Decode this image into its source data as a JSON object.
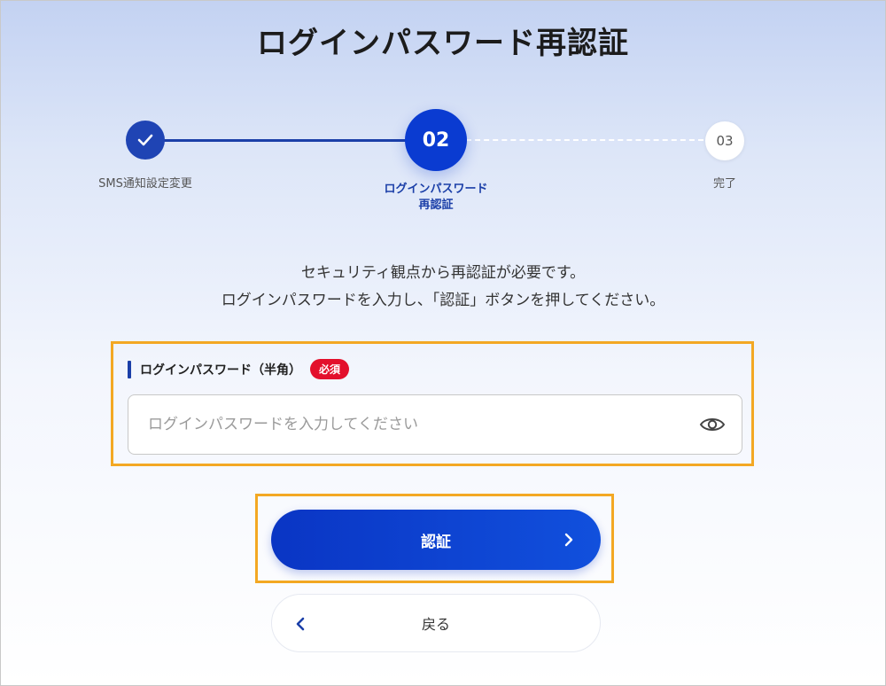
{
  "page": {
    "title": "ログインパスワード再認証"
  },
  "stepper": {
    "steps": [
      {
        "label": "SMS通知設定変更",
        "state": "done",
        "icon": "check-icon"
      },
      {
        "number": "02",
        "label": "ログインパスワード\n再認証",
        "state": "current"
      },
      {
        "number": "03",
        "label": "完了",
        "state": "upcoming"
      }
    ]
  },
  "description": {
    "line1": "セキュリティ観点から再認証が必要です。",
    "line2": "ログインパスワードを入力し、「認証」ボタンを押してください。"
  },
  "password_field": {
    "label": "ログインパスワード（半角）",
    "required_badge": "必須",
    "placeholder": "ログインパスワードを入力してください",
    "value": "",
    "icon": "eye-icon"
  },
  "buttons": {
    "authenticate": "認証",
    "back": "戻る"
  },
  "colors": {
    "primary": "#0a3bd1",
    "required": "#e3102c",
    "highlight": "#f3a823"
  }
}
